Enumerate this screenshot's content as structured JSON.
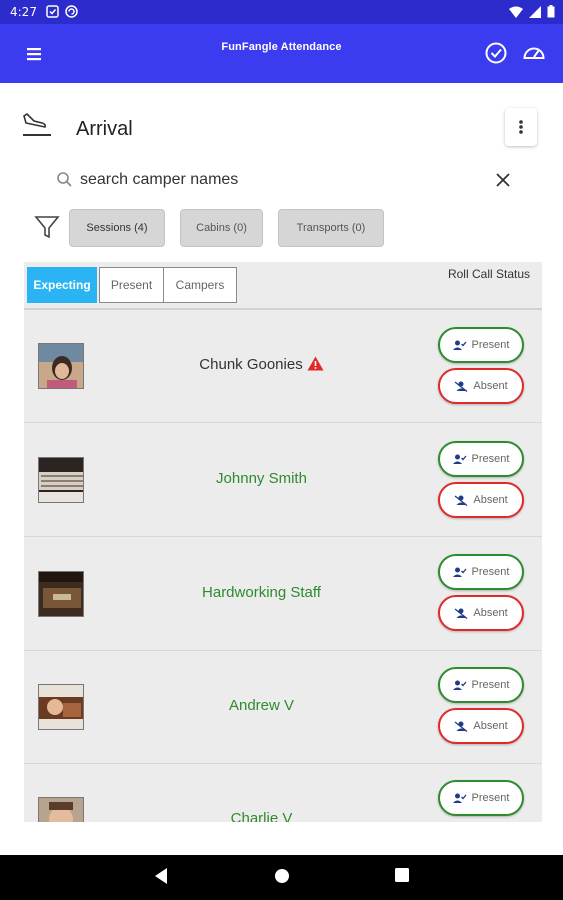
{
  "status_bar": {
    "time": "4:27"
  },
  "app_bar": {
    "title": "FunFangle Attendance"
  },
  "header": {
    "title": "Arrival"
  },
  "search": {
    "placeholder": "search camper names",
    "value": ""
  },
  "filters": {
    "sessions": "Sessions (4)",
    "cabins": "Cabins (0)",
    "transports": "Transports (0)"
  },
  "tabs": {
    "expecting": "Expecting",
    "present": "Present",
    "campers": "Campers"
  },
  "roll_call_header": "Roll Call Status",
  "buttons": {
    "present": "Present",
    "absent": "Absent"
  },
  "campers": [
    {
      "name": "Chunk Goonies",
      "warning": true
    },
    {
      "name": "Johnny Smith",
      "warning": false
    },
    {
      "name": "Hardworking Staff",
      "warning": false
    },
    {
      "name": "Andrew V",
      "warning": false
    },
    {
      "name": "Charlie V",
      "warning": false
    }
  ],
  "colors": {
    "app_bar": "#3b3bf0",
    "status_bar": "#2c2ccc",
    "active_tab": "#2ab4f4",
    "present_border": "#2e8b2e",
    "absent_border": "#e02a2a",
    "name_green": "#2e8b2e"
  }
}
